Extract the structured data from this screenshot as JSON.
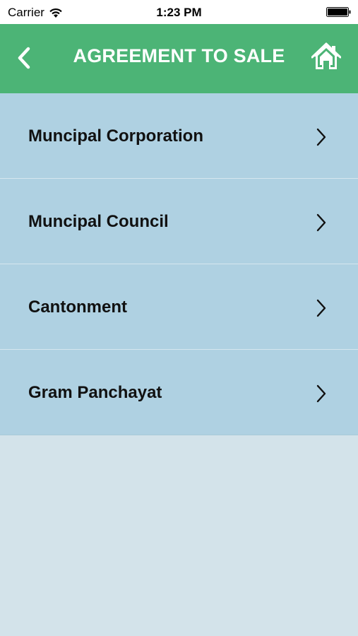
{
  "status_bar": {
    "carrier": "Carrier",
    "time": "1:23 PM"
  },
  "nav": {
    "title": "AGREEMENT TO SALE",
    "back_icon": "chevron-left-icon",
    "home_icon": "home-icon"
  },
  "list": {
    "items": [
      {
        "label": "Muncipal Corporation"
      },
      {
        "label": "Muncipal Council"
      },
      {
        "label": "Cantonment"
      },
      {
        "label": "Gram Panchayat"
      }
    ]
  },
  "colors": {
    "nav_background": "#4cb476",
    "list_background": "#afd1e2",
    "page_background": "#d3e3ea"
  }
}
